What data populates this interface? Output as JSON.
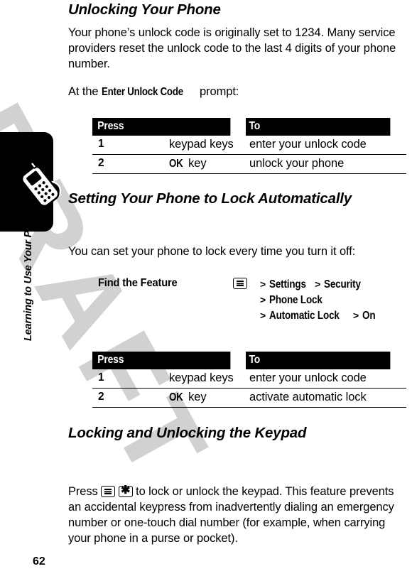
{
  "page": {
    "number": "62",
    "side_title": "Learning to Use Your Phone",
    "watermark": "DRAFT"
  },
  "sections": [
    {
      "heading": "Unlocking Your Phone",
      "paragraphs": [
        {
          "before": "Your phone’s unlock code is originally set to 1234. Many service providers reset the unlock code to the last 4 digits of your phone number.",
          "emphasis": "",
          "after": ""
        },
        {
          "before": "At the ",
          "emphasis": "Enter Unlock Code",
          "after": " prompt:"
        }
      ],
      "table": {
        "headers": [
          "Press",
          "To"
        ],
        "rows": [
          {
            "num": "1",
            "press": "keypad keys",
            "press_bold": "",
            "press_suffix": "",
            "to": "enter your unlock code"
          },
          {
            "num": "2",
            "press": "",
            "press_bold": "OK",
            "press_suffix": " key",
            "to": "unlock your phone"
          }
        ]
      }
    },
    {
      "heading": "Setting Your Phone to Lock Automatically",
      "paragraphs": [
        {
          "before": "You can set your phone to lock every time you turn it off:",
          "emphasis": "",
          "after": ""
        }
      ],
      "find_the_feature": {
        "label": "Find the Feature",
        "key_icon": "menu-key-icon",
        "path_lines": [
          {
            "items": [
              {
                "sep": ">",
                "label": "Settings"
              },
              {
                "sep": ">",
                "label": "Security"
              }
            ]
          },
          {
            "items": [
              {
                "sep": ">",
                "label": "Phone Lock"
              }
            ]
          },
          {
            "items": [
              {
                "sep": ">",
                "label": "Automatic Lock"
              },
              {
                "sep": ">",
                "label": "On"
              }
            ]
          }
        ]
      },
      "table": {
        "headers": [
          "Press",
          "To"
        ],
        "rows": [
          {
            "num": "1",
            "press": "keypad keys",
            "press_bold": "",
            "press_suffix": "",
            "to": "enter your unlock code"
          },
          {
            "num": "2",
            "press": "",
            "press_bold": "OK",
            "press_suffix": " key",
            "to": "activate automatic lock"
          }
        ]
      }
    },
    {
      "heading": "Locking and Unlocking the Keypad",
      "keypad_paragraph": {
        "lead": "Press ",
        "icon1": "menu-key-icon",
        "icon2": "star-key-icon",
        "tail": " to lock or unlock the keypad. This feature prevents an accidental keypress from inadvertently dialing an emergency number or one-touch dial number (for example, when carrying your phone in a purse or pocket)."
      }
    }
  ],
  "icons": {
    "star_glyph": "✱",
    "info_glyph": "i"
  },
  "colors": {
    "header_bar": "#000000",
    "text": "#000000",
    "watermark": "#c9c9c9",
    "page_bg": "#ffffff"
  }
}
